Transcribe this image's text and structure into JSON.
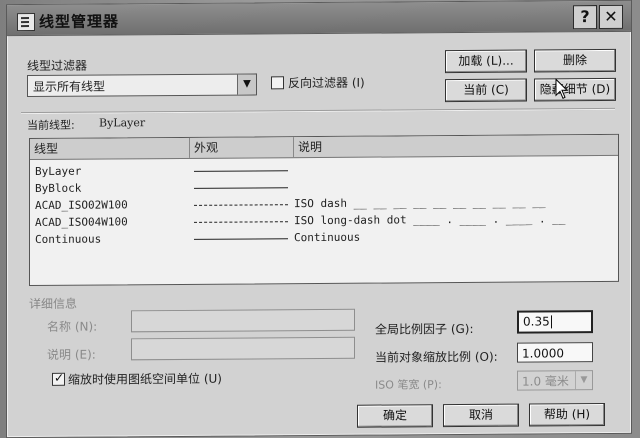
{
  "window": {
    "title": "线型管理器"
  },
  "filter": {
    "label": "线型过滤器",
    "selected": "显示所有线型",
    "invert_label": "反向过滤器 (I)"
  },
  "buttons": {
    "load": "加载 (L)...",
    "delete": "删除",
    "current": "当前 (C)",
    "hide_details": "隐藏细节 (D)",
    "ok": "确定",
    "cancel": "取消",
    "help": "帮助 (H)"
  },
  "current_linetype": {
    "label": "当前线型:",
    "value": "ByLayer"
  },
  "linetype_list": {
    "columns": [
      "线型",
      "外观",
      "说明"
    ],
    "rows": [
      {
        "name": "ByLayer",
        "appearance": "solid",
        "description": ""
      },
      {
        "name": "ByBlock",
        "appearance": "solid",
        "description": ""
      },
      {
        "name": "ACAD_ISO02W100",
        "appearance": "dash",
        "description": "ISO dash __ __ __ __ __ __ __ __ __ __"
      },
      {
        "name": "ACAD_ISO04W100",
        "appearance": "longdashdot",
        "description": "ISO long-dash dot ____ . ____ . ____ . __"
      },
      {
        "name": "Continuous",
        "appearance": "solid",
        "description": "Continuous"
      }
    ]
  },
  "details": {
    "section_label": "详细信息",
    "name_label": "名称 (N):",
    "desc_label": "说明 (E):",
    "paper_space_label": "缩放时使用图纸空间单位 (U)",
    "paper_space_checked": true,
    "global_scale_label": "全局比例因子 (G):",
    "global_scale_value": "0.35",
    "object_scale_label": "当前对象缩放比例 (O):",
    "object_scale_value": "1.0000",
    "iso_pen_label": "ISO 笔宽 (P):",
    "iso_pen_value": "1.0 毫米"
  },
  "colors": {
    "dialog_bg": "#d2d2d2",
    "titlebar": "#7f7f7f",
    "list_bg": "#f1f1f1"
  },
  "icons": [
    "linetype-manager-icon",
    "help-icon",
    "close-icon",
    "chevron-down-icon",
    "mouse-cursor-icon"
  ]
}
